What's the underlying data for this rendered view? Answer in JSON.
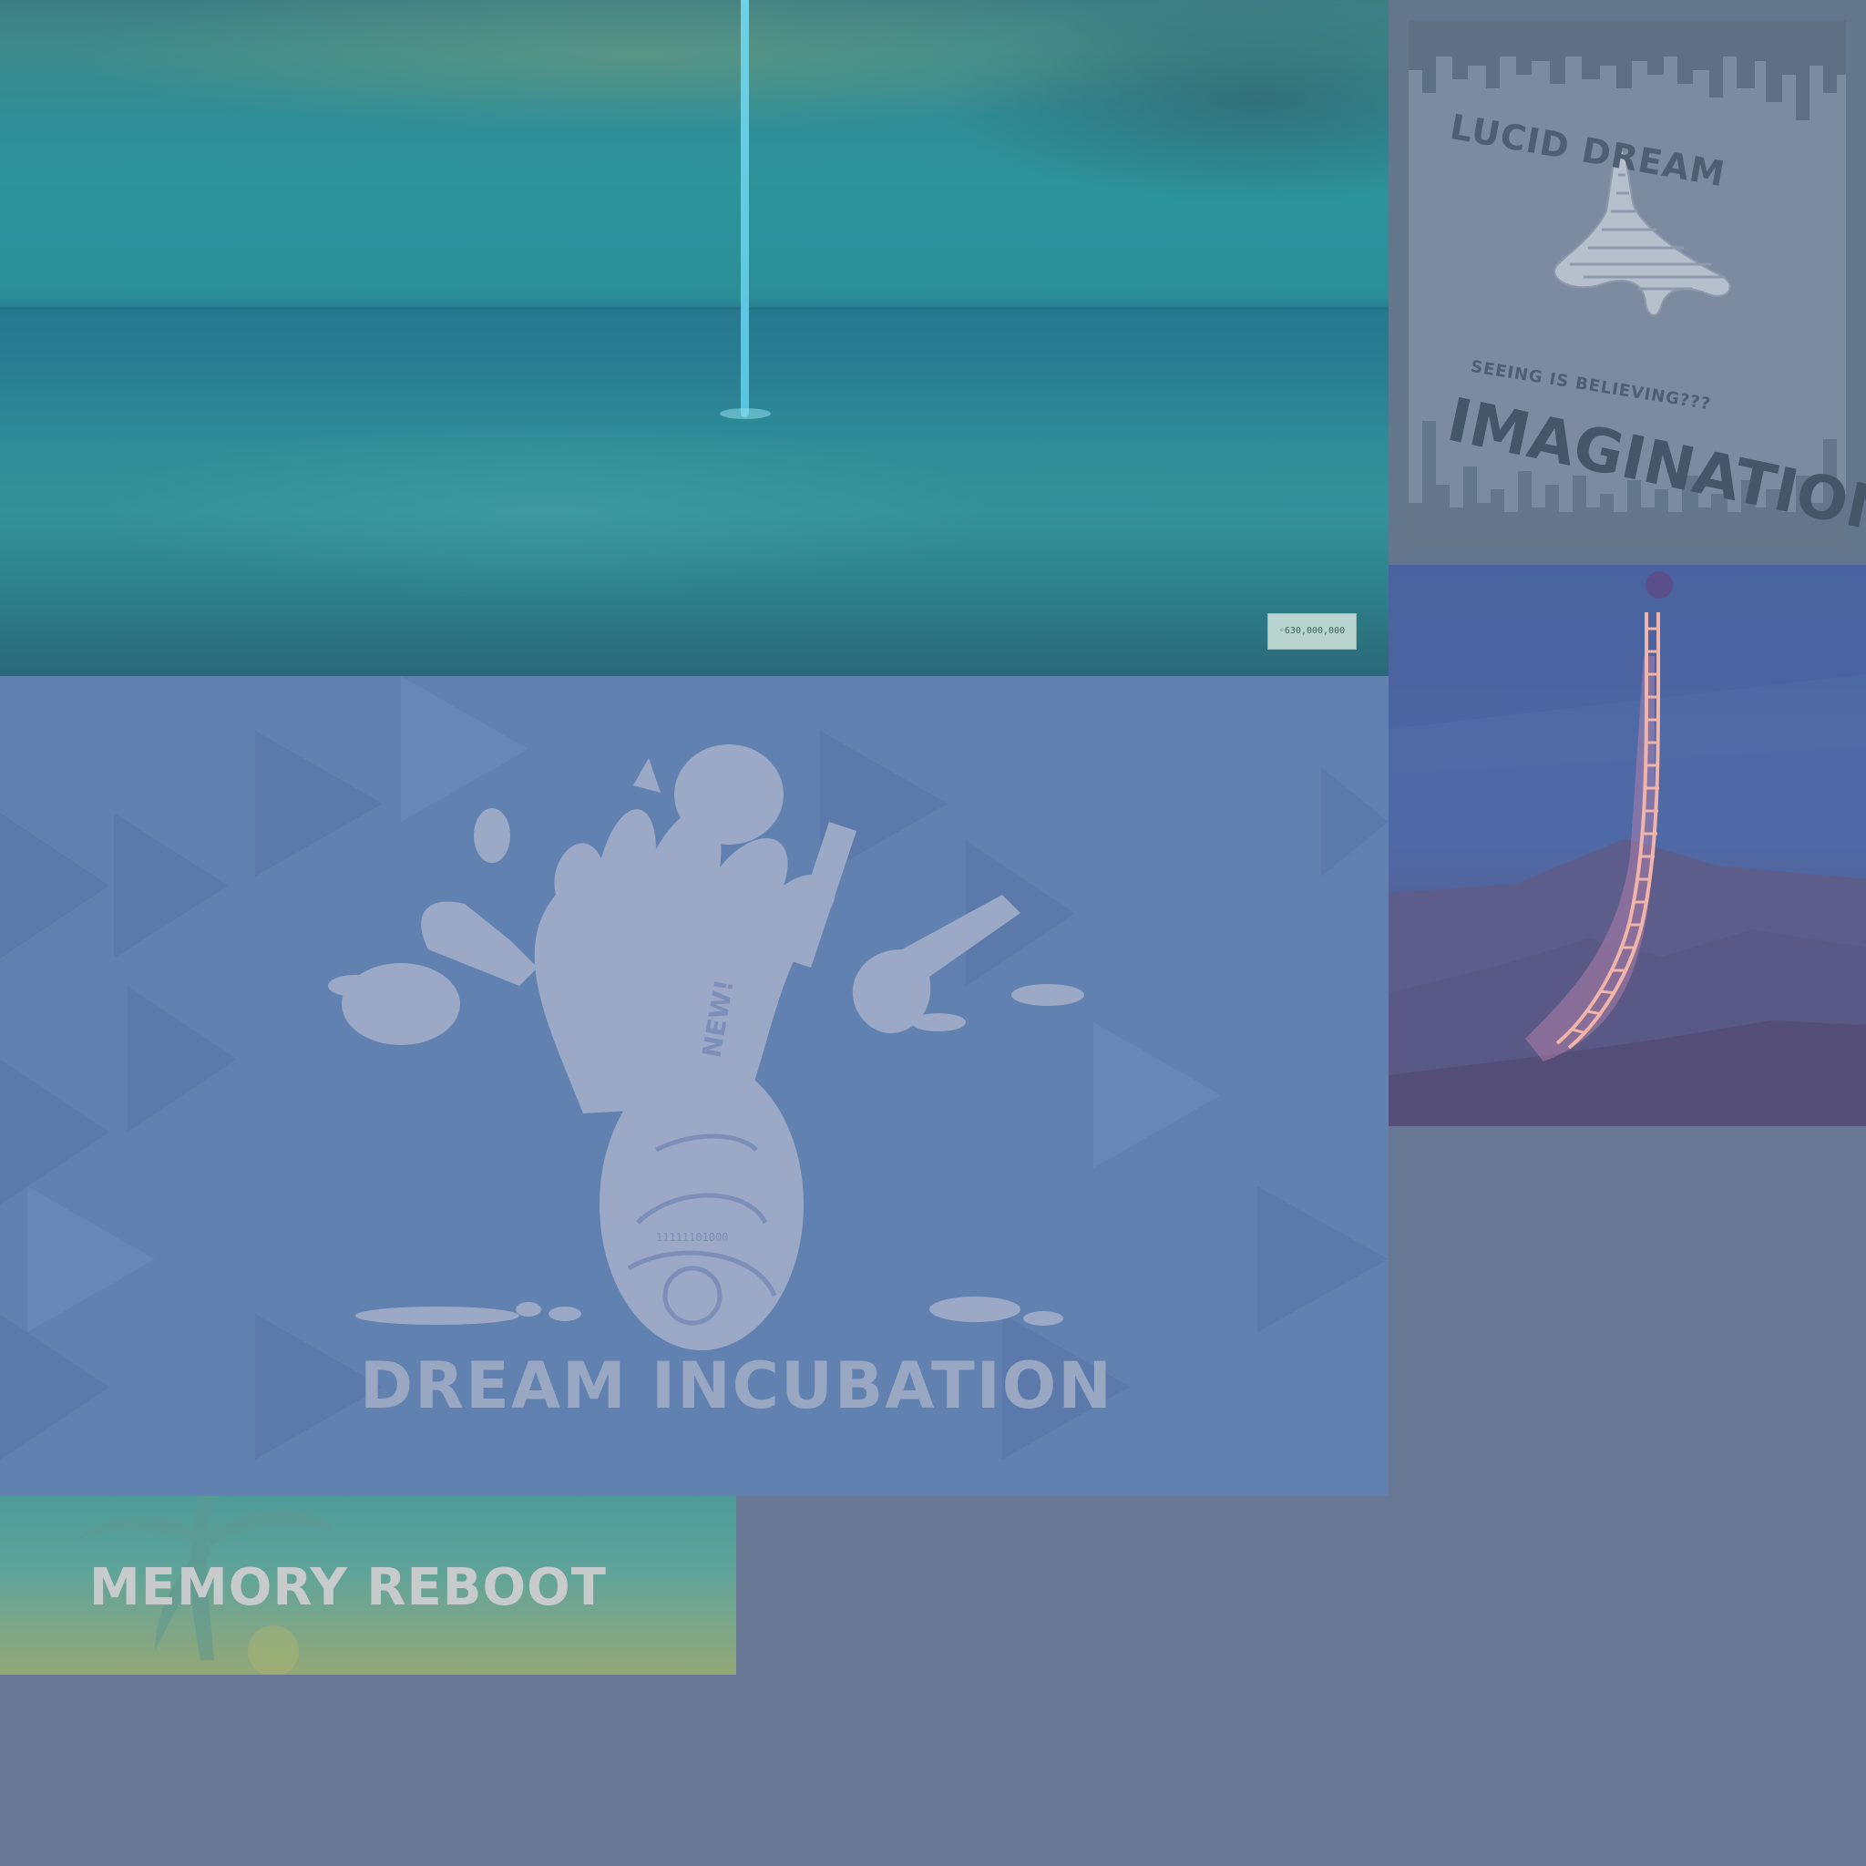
{
  "panels": {
    "ocean": {
      "counter": "◦630,000,000"
    },
    "lucid": {
      "title_top": "LUCID DREAM",
      "subtitle": "SEEING IS BELIEVING???",
      "title_bottom": "IMAGINATION"
    },
    "incubation": {
      "title": "DREAM INCUBATION",
      "badge": "NEW!",
      "egg_code": "11111101000"
    },
    "memory": {
      "title": "MEMORY REBOOT"
    }
  },
  "colors": {
    "background": "#687793",
    "incubation_bg": "#6182b0",
    "lucid_bg": "#7d8ba0",
    "stream": "#6fd0e6"
  }
}
